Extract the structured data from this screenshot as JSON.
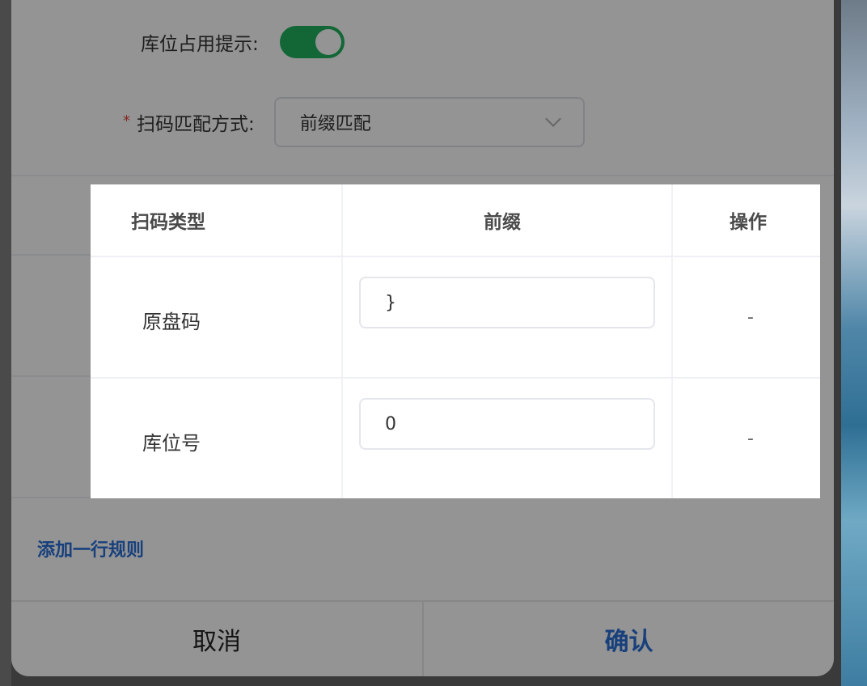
{
  "form": {
    "occupy_hint_label": "库位占用提示:",
    "scan_match_label": "扫码匹配方式:",
    "scan_match_value": "前缀匹配",
    "required_mark": "*"
  },
  "table": {
    "headers": [
      "扫码类型",
      "前缀",
      "操作"
    ],
    "rows": [
      {
        "type": "原盘码",
        "prefix": "}",
        "op": "-"
      },
      {
        "type": "库位号",
        "prefix": "0",
        "op": "-"
      }
    ]
  },
  "add_rule_label": "添加一行规则",
  "footer": {
    "cancel_label": "取消",
    "confirm_label": "确认"
  },
  "colors": {
    "toggle_on": "#22b25d",
    "link_blue": "#2a6fd6",
    "required_red": "#e0463a"
  }
}
